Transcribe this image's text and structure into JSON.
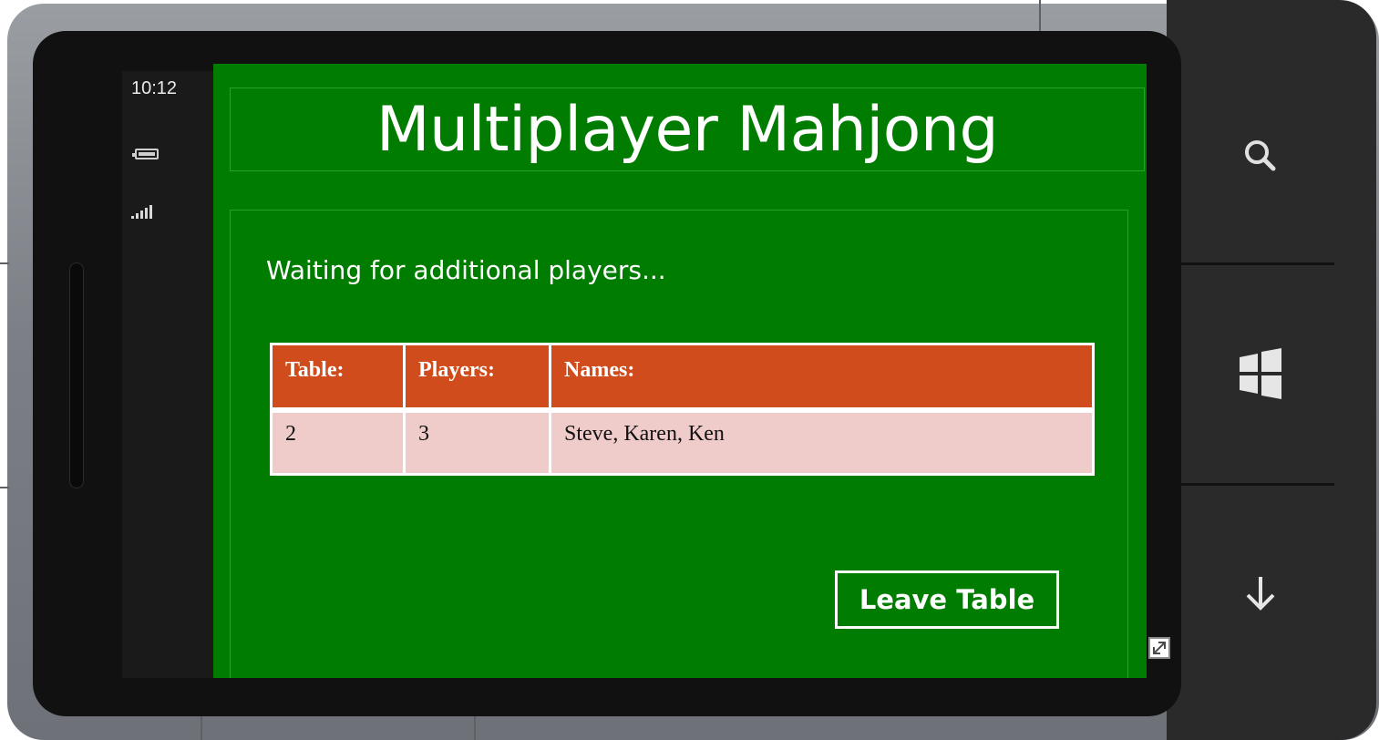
{
  "status_bar": {
    "time": "10:12",
    "icons": [
      "battery-icon",
      "signal-icon"
    ]
  },
  "screen": {
    "title": "Multiplayer Mahjong",
    "status_text": "Waiting for additional players...",
    "table": {
      "headers": [
        "Table:",
        "Players:",
        "Names:"
      ],
      "rows": [
        [
          "2",
          "3",
          "Steve, Karen, Ken"
        ]
      ]
    },
    "leave_button_label": "Leave Table"
  },
  "hardware_buttons": [
    "search-icon",
    "windows-start-icon",
    "back-icon"
  ],
  "colors": {
    "screen_background": "#007d00",
    "table_header": "#d14c1c",
    "table_row": "#efcbc9"
  }
}
